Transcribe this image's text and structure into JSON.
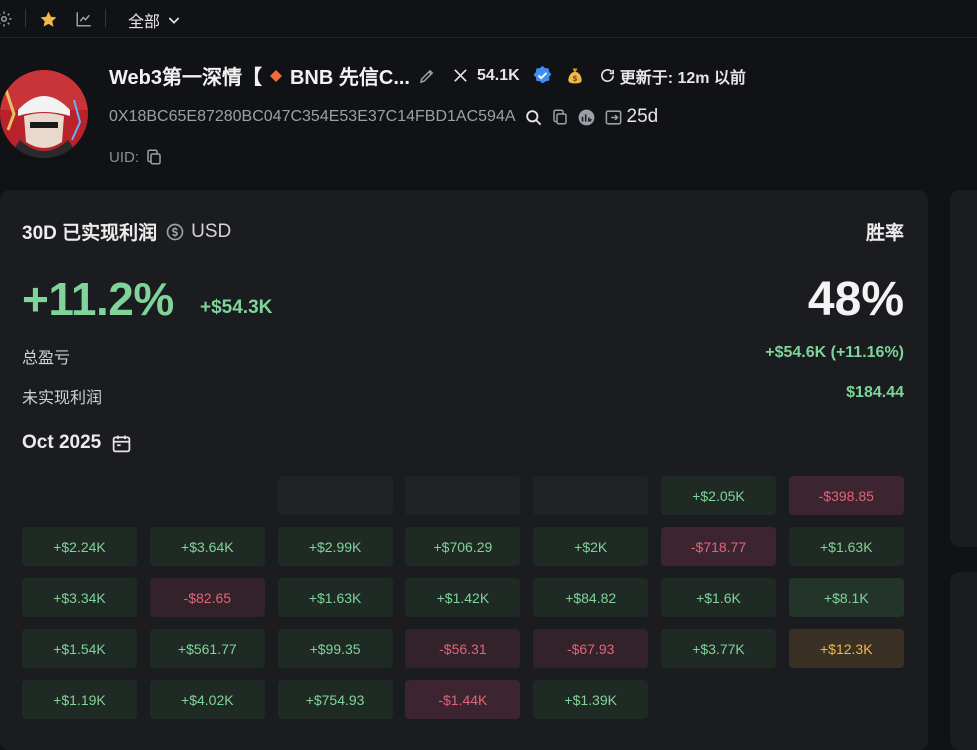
{
  "topbar": {
    "filter_label": "全部",
    "icons": [
      "settings-icon",
      "star-icon",
      "chart-icon",
      "chevron-down-icon"
    ]
  },
  "profile": {
    "name": "Web3第一深情【",
    "chain": "BNB 先信C...",
    "x_followers": "54.1K",
    "updated": "更新于: 12m 以前",
    "address": "0X18BC65E87280BC047C354E53E37C14FBD1AC594A",
    "age": "25d",
    "uid_label": "UID:"
  },
  "pnl": {
    "title": "30D 已实现利润",
    "currency": "USD",
    "pct": "+11.2%",
    "usd": "+$54.3K",
    "winrate_label": "胜率",
    "winrate": "48%",
    "total_label": "总盈亏",
    "total_value": "+$54.6K (+11.16%)",
    "unrealized_label": "未实现利润",
    "unrealized_value": "$184.44"
  },
  "calendar": {
    "month": "Oct 2025",
    "cells": [
      {
        "v": "",
        "t": "blank"
      },
      {
        "v": "",
        "t": "blank"
      },
      {
        "v": "",
        "t": "empty"
      },
      {
        "v": "",
        "t": "empty"
      },
      {
        "v": "",
        "t": "empty"
      },
      {
        "v": "+$2.05K",
        "t": "pos"
      },
      {
        "v": "-$398.85",
        "t": "neg2"
      },
      {
        "v": "+$2.24K",
        "t": "pos"
      },
      {
        "v": "+$3.64K",
        "t": "pos"
      },
      {
        "v": "+$2.99K",
        "t": "pos"
      },
      {
        "v": "+$706.29",
        "t": "pos"
      },
      {
        "v": "+$2K",
        "t": "pos"
      },
      {
        "v": "-$718.77",
        "t": "neg2"
      },
      {
        "v": "+$1.63K",
        "t": "pos"
      },
      {
        "v": "+$3.34K",
        "t": "pos"
      },
      {
        "v": "-$82.65",
        "t": "neg"
      },
      {
        "v": "+$1.63K",
        "t": "pos"
      },
      {
        "v": "+$1.42K",
        "t": "pos"
      },
      {
        "v": "+$84.82",
        "t": "pos"
      },
      {
        "v": "+$1.6K",
        "t": "pos"
      },
      {
        "v": "+$8.1K",
        "t": "pos2"
      },
      {
        "v": "+$1.54K",
        "t": "pos"
      },
      {
        "v": "+$561.77",
        "t": "pos"
      },
      {
        "v": "+$99.35",
        "t": "pos"
      },
      {
        "v": "-$56.31",
        "t": "neg"
      },
      {
        "v": "-$67.93",
        "t": "neg"
      },
      {
        "v": "+$3.77K",
        "t": "pos"
      },
      {
        "v": "+$12.3K",
        "t": "gold"
      },
      {
        "v": "+$1.19K",
        "t": "pos"
      },
      {
        "v": "+$4.02K",
        "t": "pos"
      },
      {
        "v": "+$754.93",
        "t": "pos"
      },
      {
        "v": "-$1.44K",
        "t": "neg2"
      },
      {
        "v": "+$1.39K",
        "t": "pos"
      }
    ]
  },
  "colors": {
    "positive": "#7fd49a",
    "negative": "#e0657a",
    "highlight": "#f0b848",
    "verified": "#3d8ef0"
  }
}
